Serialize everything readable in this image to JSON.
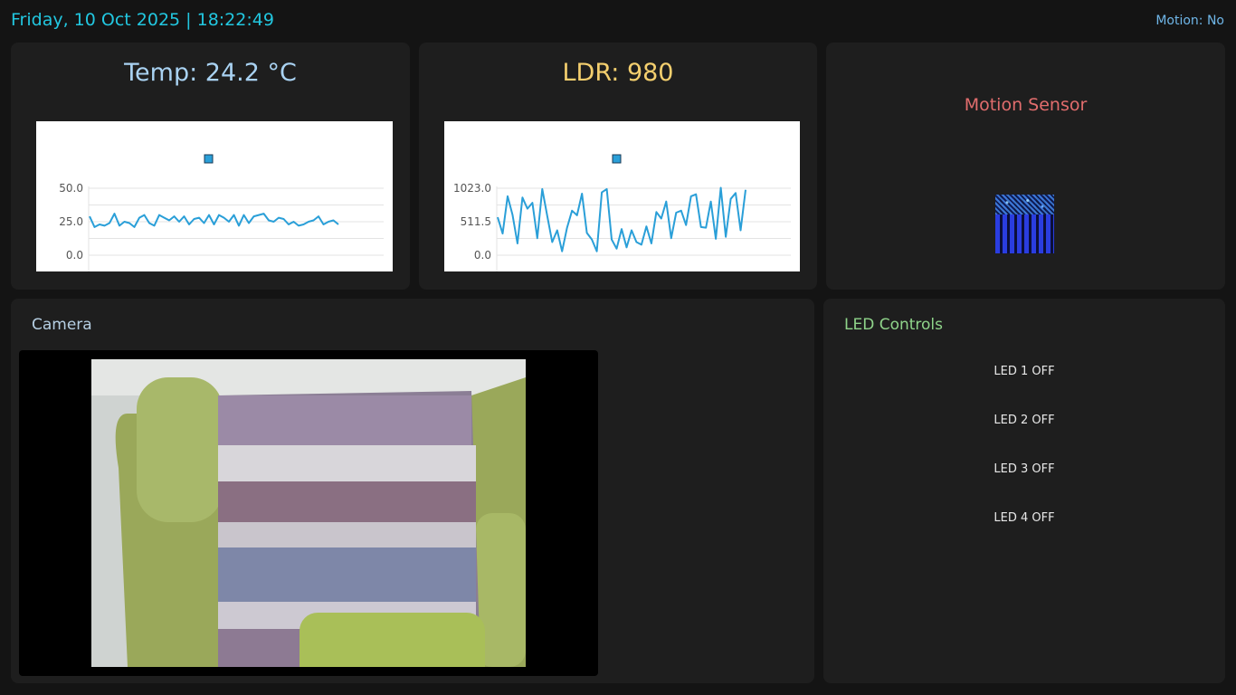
{
  "header": {
    "datetime": "Friday, 10 Oct 2025 | 18:22:49",
    "motion_status": "Motion: No"
  },
  "temp": {
    "reading": "Temp: 24.2 °C"
  },
  "ldr": {
    "reading": "LDR: 980"
  },
  "motion": {
    "title": "Motion Sensor",
    "image_icon": "motion-snapshot"
  },
  "camera": {
    "title": "Camera"
  },
  "leds": {
    "title": "LED Controls",
    "buttons": [
      "LED 1 OFF",
      "LED 2 OFF",
      "LED 3 OFF",
      "LED 4 OFF"
    ]
  },
  "colors": {
    "line": "#2a9fd8",
    "datetime": "#22c7e0",
    "temp": "#a9d2f2",
    "ldr": "#f4cf6e",
    "motion": "#e26d6d",
    "led_title": "#8fd48a"
  },
  "chart_data": [
    {
      "type": "line",
      "title": "",
      "series": [
        {
          "values": [
            29,
            21,
            23,
            22,
            24,
            31,
            22,
            25,
            24,
            21,
            28,
            30,
            24,
            22,
            30,
            28,
            26,
            29,
            25,
            29,
            23,
            27,
            28,
            24,
            30,
            23,
            30,
            28,
            25,
            30,
            22,
            30,
            24,
            29,
            30,
            31,
            26,
            25,
            28,
            27,
            23,
            25,
            22,
            23,
            25,
            26,
            29,
            23,
            25,
            26,
            23
          ]
        }
      ],
      "yticks": [
        "50.0",
        "25.0",
        "0.0"
      ],
      "ylim": [
        0,
        50
      ],
      "grid": true,
      "legend": "top"
    },
    {
      "type": "line",
      "title": "",
      "series": [
        {
          "values": [
            580,
            330,
            900,
            620,
            180,
            880,
            710,
            800,
            260,
            1010,
            600,
            200,
            380,
            60,
            420,
            680,
            610,
            940,
            340,
            240,
            60,
            960,
            1010,
            240,
            100,
            400,
            120,
            380,
            200,
            160,
            440,
            180,
            660,
            560,
            820,
            260,
            650,
            680,
            460,
            900,
            930,
            430,
            420,
            820,
            250,
            1030,
            280,
            860,
            950,
            380,
            1000
          ]
        }
      ],
      "yticks": [
        "1023.0",
        "511.5",
        "0.0"
      ],
      "ylim": [
        0,
        1023
      ],
      "grid": true,
      "legend": "top"
    }
  ]
}
